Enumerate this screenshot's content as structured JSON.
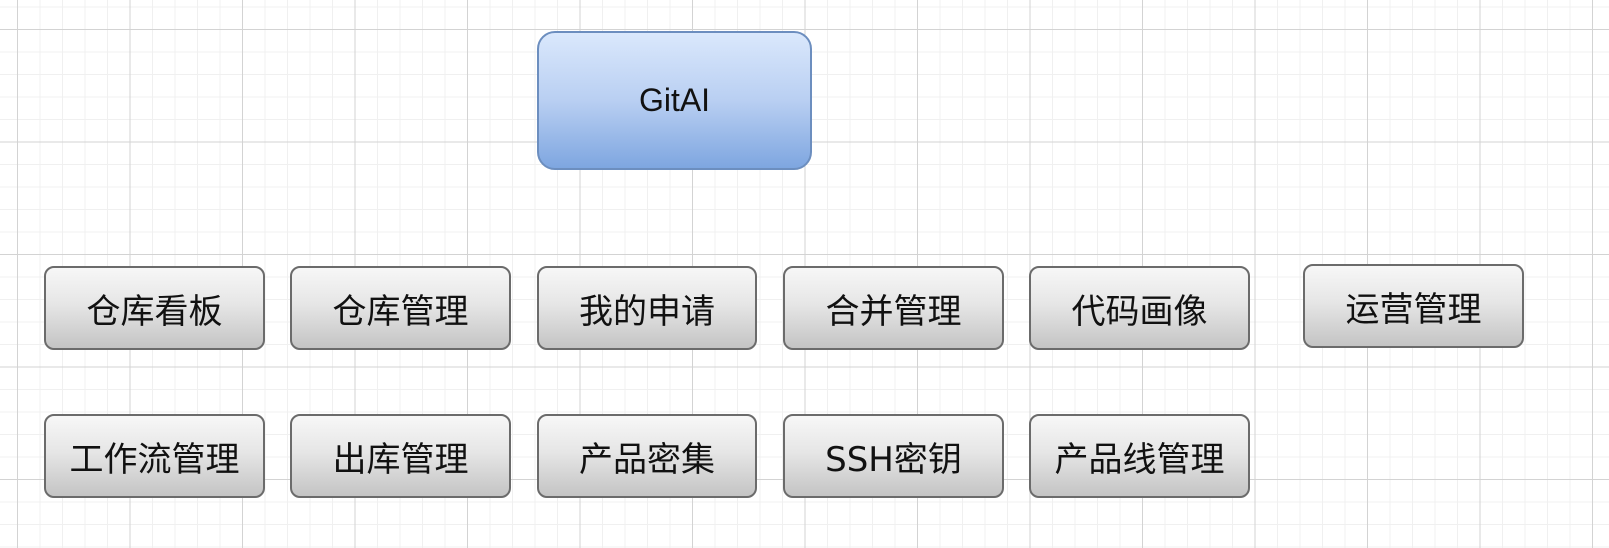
{
  "diagram": {
    "root": {
      "label": "GitAI"
    },
    "row1": [
      {
        "label": "仓库看板"
      },
      {
        "label": "仓库管理"
      },
      {
        "label": "我的申请"
      },
      {
        "label": "合并管理"
      },
      {
        "label": "代码画像"
      },
      {
        "label": "运营管理"
      }
    ],
    "row2": [
      {
        "label": "工作流管理"
      },
      {
        "label": "出库管理"
      },
      {
        "label": "产品密集"
      },
      {
        "label": "SSH密钥"
      },
      {
        "label": "产品线管理"
      }
    ]
  },
  "colors": {
    "root_fill_top": "#dae8fc",
    "root_fill_bottom": "#7ea6e0",
    "root_border": "#6c8ebf",
    "node_fill_top": "#f7f7f7",
    "node_fill_bottom": "#c4c4c4",
    "node_border": "#6b6b6b"
  }
}
